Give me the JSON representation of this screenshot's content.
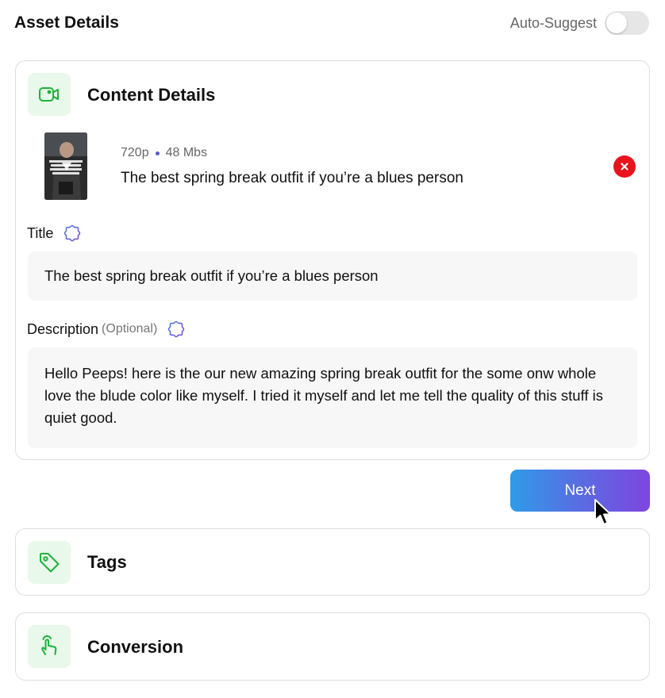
{
  "header": {
    "title": "Asset Details",
    "auto_suggest_label": "Auto-Suggest",
    "auto_suggest_on": false
  },
  "content_details": {
    "section_title": "Content Details",
    "icon": "video-icon",
    "media": {
      "resolution": "720p",
      "size": "48 Mbs",
      "title": "The best spring break outfit if you’re a blues person",
      "remove_icon": "close-icon"
    },
    "title_field": {
      "label": "Title",
      "value": "The best spring break outfit if you’re a blues person",
      "ai_icon": "sparkle-icon"
    },
    "description_field": {
      "label": "Description",
      "optional_label": "(Optional)",
      "value": "Hello Peeps! here is the our new amazing spring break outfit for the some onw whole love the blude color like myself. I tried it myself and let me tell the quality of this stuff is quiet good.",
      "ai_icon": "sparkle-icon"
    }
  },
  "next_button": {
    "label": "Next"
  },
  "tags_section": {
    "section_title": "Tags",
    "icon": "tag-icon"
  },
  "conversion_section": {
    "section_title": "Conversion",
    "icon": "hand-pointer-icon"
  },
  "colors": {
    "accent_green": "#1db33a",
    "icon_bg": "#e8f8ea",
    "remove_red": "#e8131b",
    "sparkle_purple": "#5b57d8",
    "button_gradient_start": "#2f9be8",
    "button_gradient_end": "#7f45e0"
  }
}
